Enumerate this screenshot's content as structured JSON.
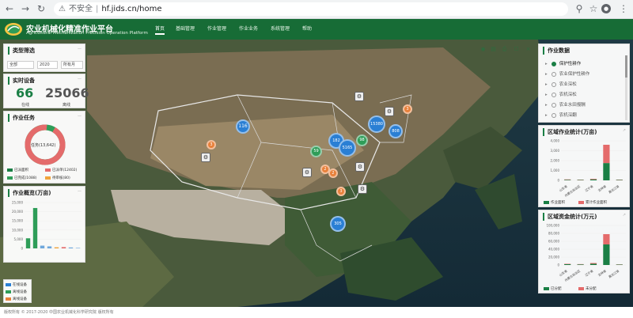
{
  "browser": {
    "url_warning": "不安全",
    "url": "hf.jids.cn/home"
  },
  "header": {
    "title_zh": "农业机械化精准作业平台",
    "title_en": "Agricultural Mechanization Precision Operation Platform",
    "nav": [
      "首页",
      "基础管理",
      "作业管理",
      "作业业务",
      "系统管理",
      "帮助"
    ],
    "active_nav": "首页",
    "brand_color": "#176c36"
  },
  "filter": {
    "title": "类型筛选",
    "type": "全部",
    "year": "2020",
    "month": "所有月"
  },
  "devices": {
    "title": "实时设备",
    "online": "66",
    "online_label": "在线",
    "total": "25066",
    "total_label": "离线"
  },
  "tasks": {
    "title": "作业任务",
    "center": "任务(13,642)",
    "done_fraction": 0.93,
    "legend": [
      {
        "label": "已派面积",
        "color": "#1a7f45"
      },
      {
        "label": "已派单(12402)",
        "color": "#e46b6b"
      },
      {
        "label": "已完成(1088)",
        "color": "#2e9d58"
      },
      {
        "label": "待审核(80)",
        "color": "#f0a33b"
      }
    ]
  },
  "ops": {
    "title": "作业概览(万亩)",
    "chart_data": {
      "type": "bar",
      "ylim": [
        0,
        25000
      ],
      "yticks": [
        "25,000",
        "20,000",
        "15,000",
        "10,000",
        "5,000",
        "0"
      ],
      "values": [
        5500,
        22000,
        1500,
        1100,
        600,
        700,
        500,
        400
      ],
      "colors": [
        "#2e9d58",
        "#2e9d58",
        "#6fa8dc",
        "#6fa8dc",
        "#f0a33b",
        "#e46b6b",
        "#6fa8dc",
        "#9fc5e8"
      ]
    }
  },
  "map_legend": [
    "在线设备",
    "离线设备",
    "离线设备"
  ],
  "worktype": {
    "title": "作业数据",
    "items": [
      {
        "label": "保护性耕作",
        "checked": true
      },
      {
        "label": "农业保护性耕作",
        "checked": false
      },
      {
        "label": "农业深松",
        "checked": false
      },
      {
        "label": "农机深松",
        "checked": false
      },
      {
        "label": "农业水田报酬",
        "checked": false
      },
      {
        "label": "农机深翻",
        "checked": false
      }
    ]
  },
  "region_ops": {
    "title": "区域作业统计(万亩)",
    "chart_data": {
      "type": "bar",
      "ylim": [
        0,
        4000
      ],
      "yticks": [
        "4,000",
        "3,000",
        "2,000",
        "1,000",
        "0"
      ],
      "categories": [
        "山东省",
        "内蒙古自治区",
        "辽宁省",
        "吉林省",
        "黑龙江省"
      ],
      "series": [
        {
          "name": "作业面积",
          "color": "#1a7f45",
          "values": [
            60,
            40,
            100,
            1750,
            50
          ]
        },
        {
          "name": "累计作业面积",
          "color": "#e46b6b",
          "values": [
            40,
            30,
            60,
            1850,
            30
          ]
        }
      ]
    },
    "legend": [
      "作业面积",
      "累计作业面积"
    ]
  },
  "region_funds": {
    "title": "区域资金统计(万元)",
    "chart_data": {
      "type": "bar",
      "ylim": [
        0,
        100000
      ],
      "yticks": [
        "100,000",
        "80,000",
        "60,000",
        "40,000",
        "20,000",
        "0"
      ],
      "categories": [
        "山东省",
        "内蒙古自治区",
        "辽宁省",
        "吉林省",
        "黑龙江省"
      ],
      "series": [
        {
          "name": "已分配",
          "color": "#1a7f45",
          "values": [
            2000,
            1500,
            3000,
            52000,
            1000
          ]
        },
        {
          "name": "未分配",
          "color": "#e46b6b",
          "values": [
            1000,
            800,
            2000,
            26000,
            600
          ]
        }
      ]
    },
    "legend": [
      "已分配",
      "未分配"
    ]
  },
  "map": {
    "bubbles": [
      {
        "label": "116",
        "color": "#2a7fd4"
      },
      {
        "label": "3",
        "color": "#e8803a"
      },
      {
        "label": "15380",
        "color": "#2a7fd4"
      },
      {
        "label": "808",
        "color": "#2a7fd4"
      },
      {
        "label": "182",
        "color": "#2a7fd4"
      },
      {
        "label": "5165",
        "color": "#2a7fd4"
      },
      {
        "label": "98",
        "color": "#2e9d58"
      },
      {
        "label": "59",
        "color": "#2e9d58"
      },
      {
        "label": "3",
        "color": "#e8803a"
      },
      {
        "label": "2",
        "color": "#e8803a"
      },
      {
        "label": "3",
        "color": "#e8803a"
      },
      {
        "label": "305",
        "color": "#2a7fd4"
      },
      {
        "label": "2",
        "color": "#e8803a"
      }
    ]
  },
  "footer": "版权所有 © 2017-2020 中国农业机械化科学研究院 版权所有"
}
